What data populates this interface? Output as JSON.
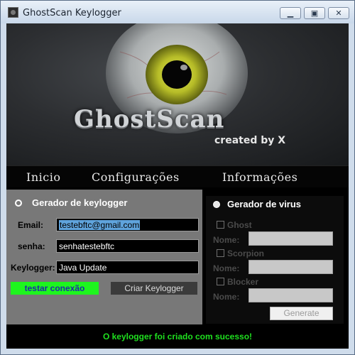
{
  "window": {
    "title": "GhostScan Keylogger",
    "minimize_symbol": "▁",
    "maximize_symbol": "▣",
    "close_symbol": "✕"
  },
  "banner": {
    "brand": "GhostScan",
    "credit": "created by X"
  },
  "nav": {
    "items": [
      {
        "label": "Inicio"
      },
      {
        "label": "Configurações"
      },
      {
        "label": "Informações"
      }
    ]
  },
  "keylogger": {
    "title": "Gerador de keylogger",
    "email_label": "Email:",
    "email_value": "testebftc@gmail.com",
    "senha_label": "senha:",
    "senha_value": "senhatestebftc",
    "keylogger_label": "Keylogger:",
    "keylogger_value": "Java Update",
    "test_button": "testar conexão",
    "create_button": "Criar Keylogger"
  },
  "virus": {
    "title": "Gerador de virus",
    "options": [
      {
        "label": "Ghost",
        "checked": false
      },
      {
        "label": "Scorpion",
        "checked": false
      },
      {
        "label": "Blocker",
        "checked": false
      }
    ],
    "nome_label": "Nome:",
    "generate_button": "Generate"
  },
  "status": {
    "message": "O keylogger foi criado com sucesso!"
  },
  "colors": {
    "status_text": "#1fe01f",
    "test_button_bg": "#1ef51e",
    "iris": "#b7bd28",
    "selection": "#5fa3dc"
  },
  "icons": {
    "app": "ghost-app-icon",
    "eye": "eyeball-illustration"
  }
}
